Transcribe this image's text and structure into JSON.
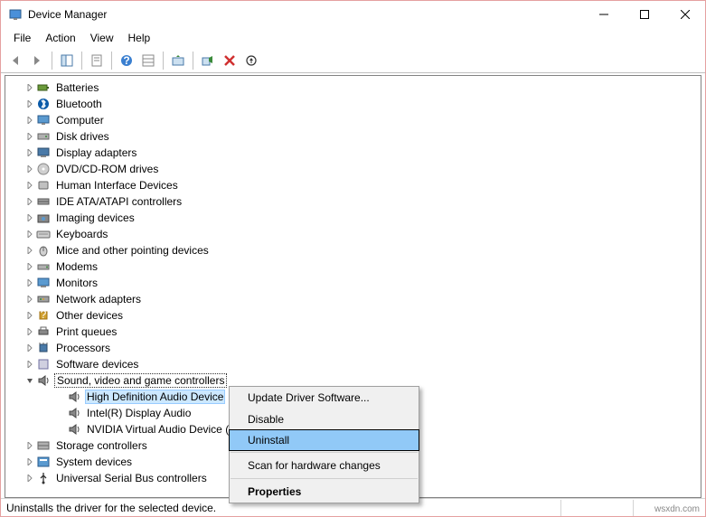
{
  "window": {
    "title": "Device Manager"
  },
  "menubar": [
    "File",
    "Action",
    "View",
    "Help"
  ],
  "tree": {
    "categories": [
      {
        "label": "Batteries",
        "icon": "battery"
      },
      {
        "label": "Bluetooth",
        "icon": "bluetooth"
      },
      {
        "label": "Computer",
        "icon": "computer"
      },
      {
        "label": "Disk drives",
        "icon": "disk"
      },
      {
        "label": "Display adapters",
        "icon": "display"
      },
      {
        "label": "DVD/CD-ROM drives",
        "icon": "dvd"
      },
      {
        "label": "Human Interface Devices",
        "icon": "hid"
      },
      {
        "label": "IDE ATA/ATAPI controllers",
        "icon": "ide"
      },
      {
        "label": "Imaging devices",
        "icon": "imaging"
      },
      {
        "label": "Keyboards",
        "icon": "keyboard"
      },
      {
        "label": "Mice and other pointing devices",
        "icon": "mouse"
      },
      {
        "label": "Modems",
        "icon": "modem"
      },
      {
        "label": "Monitors",
        "icon": "monitor"
      },
      {
        "label": "Network adapters",
        "icon": "network"
      },
      {
        "label": "Other devices",
        "icon": "other"
      },
      {
        "label": "Print queues",
        "icon": "printer"
      },
      {
        "label": "Processors",
        "icon": "cpu"
      },
      {
        "label": "Software devices",
        "icon": "software"
      }
    ],
    "expanded": {
      "label": "Sound, video and game controllers",
      "icon": "sound",
      "children": [
        {
          "label": "High Definition Audio Device",
          "selected": true
        },
        {
          "label": "Intel(R) Display Audio",
          "selected": false
        },
        {
          "label": "NVIDIA Virtual Audio Device (",
          "selected": false
        }
      ]
    },
    "after": [
      {
        "label": "Storage controllers",
        "icon": "storage"
      },
      {
        "label": "System devices",
        "icon": "system"
      },
      {
        "label": "Universal Serial Bus controllers",
        "icon": "usb"
      }
    ]
  },
  "context_menu": {
    "items": [
      {
        "label": "Update Driver Software...",
        "highlighted": false
      },
      {
        "label": "Disable",
        "highlighted": false
      },
      {
        "label": "Uninstall",
        "highlighted": true
      },
      {
        "sep": true
      },
      {
        "label": "Scan for hardware changes",
        "highlighted": false
      },
      {
        "sep": true
      },
      {
        "label": "Properties",
        "bold": true
      }
    ]
  },
  "statusbar": {
    "text": "Uninstalls the driver for the selected device."
  },
  "watermark": "wsxdn.com"
}
